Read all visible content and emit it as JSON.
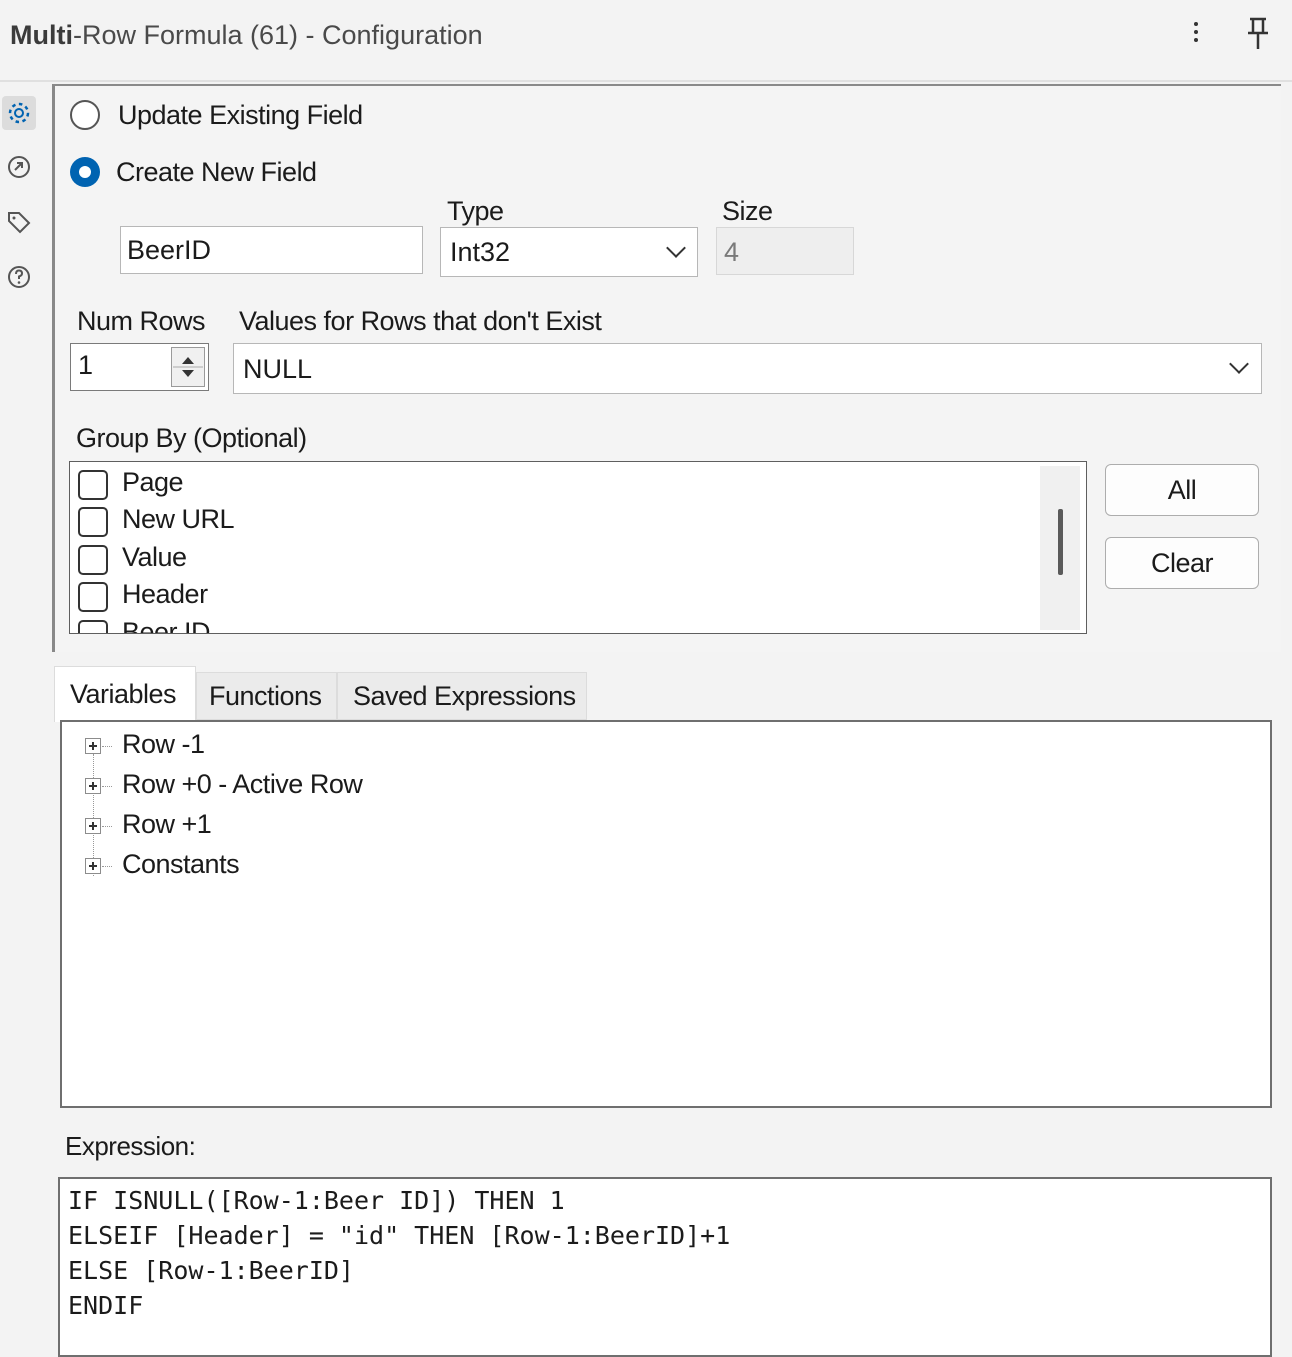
{
  "header": {
    "title_bold": "Multi",
    "title_rest": "-Row Formula (61) - Configuration"
  },
  "rail": {
    "icons": [
      "gear-icon",
      "connections-icon",
      "tag-icon",
      "help-icon"
    ]
  },
  "config": {
    "update_existing_label": "Update Existing Field",
    "create_new_label": "Create New  Field",
    "selected_mode": "create_new",
    "type_label": "Type",
    "size_label": "Size",
    "field_name_value": "BeerID",
    "type_value": "Int32",
    "size_value": "4",
    "num_rows_label": "Num Rows",
    "num_rows_value": "1",
    "values_label": "Values for Rows that don't Exist",
    "values_value": "NULL",
    "group_by_label": "Group By (Optional)",
    "group_by_items": [
      "Page",
      "New URL",
      "Value",
      "Header",
      "Beer ID"
    ],
    "all_button": "All",
    "clear_button": "Clear"
  },
  "tabs": [
    "Variables",
    "Functions",
    "Saved Expressions"
  ],
  "active_tab": "Variables",
  "variables": [
    "Row -1",
    "Row +0 - Active Row",
    "Row +1",
    "Constants"
  ],
  "expression": {
    "label": "Expression:",
    "lines": [
      "IF ISNULL([Row-1:Beer ID]) THEN 1",
      "ELSEIF [Header] = \"id\" THEN [Row-1:BeerID]+1",
      "ELSE [Row-1:BeerID]",
      "ENDIF"
    ]
  },
  "colors": {
    "accent": "#0063b1",
    "background": "#f3f3f3"
  }
}
